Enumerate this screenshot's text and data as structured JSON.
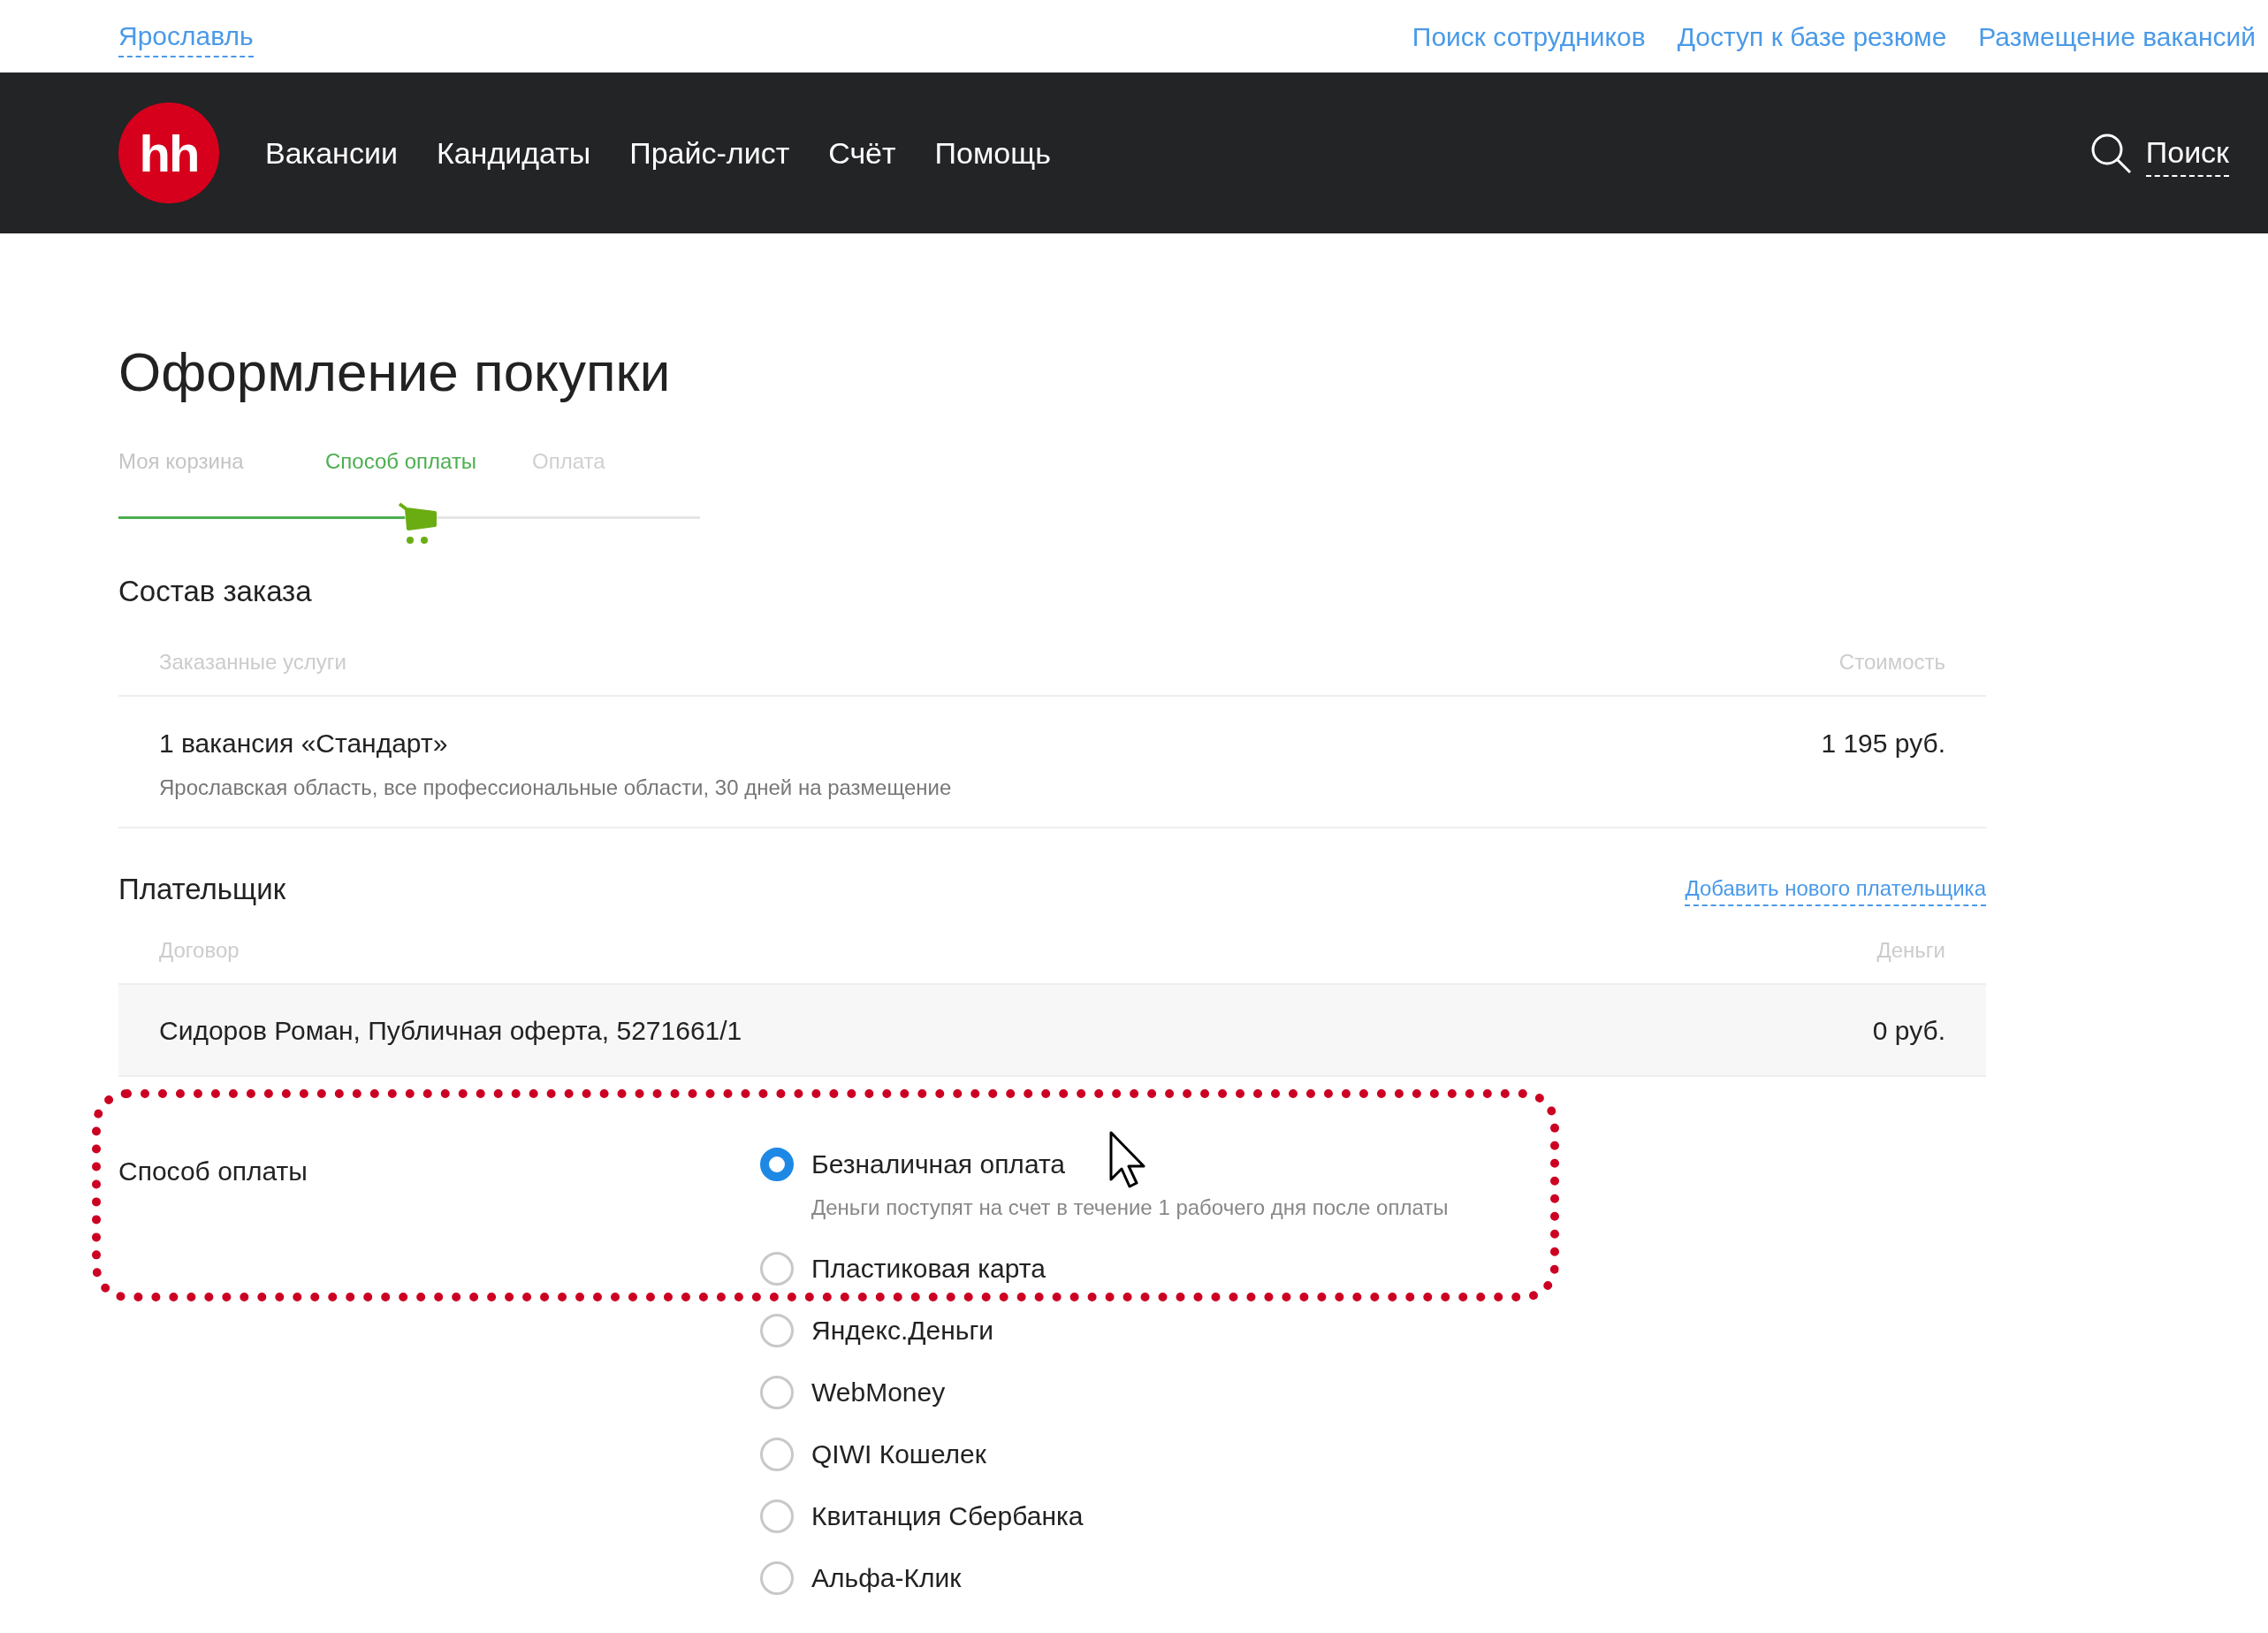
{
  "top_bar": {
    "city": "Ярославль",
    "links": [
      "Поиск сотрудников",
      "Доступ к базе резюме",
      "Размещение вакансий"
    ]
  },
  "navbar": {
    "logo": "hh",
    "items": [
      "Вакансии",
      "Кандидаты",
      "Прайс-лист",
      "Счёт",
      "Помощь"
    ],
    "search": "Поиск"
  },
  "title": "Оформление покупки",
  "steps": [
    {
      "label": "Моя корзина",
      "done": true,
      "selected": false
    },
    {
      "label": "Способ оплаты",
      "done": false,
      "selected": true
    },
    {
      "label": "Оплата",
      "done": false,
      "selected": false
    }
  ],
  "order": {
    "heading": "Состав заказа",
    "columns": [
      "Заказанные услуги",
      "Стоимость"
    ],
    "rows": [
      {
        "name": "1 вакансия «Стандарт»",
        "details": "Ярославская область, все профессиональные области, 30 дней на размещение",
        "price": "1 195 руб."
      }
    ]
  },
  "payer": {
    "heading": "Плательщик",
    "add_link": "Добавить нового плательщика",
    "columns": [
      "Договор",
      "Деньги"
    ],
    "rows": [
      {
        "name": "Сидоров Роман, Публичная оферта, 5271661/1",
        "money": "0 руб."
      }
    ]
  },
  "payment": {
    "label": "Способ оплаты",
    "options": [
      {
        "label": "Безналичная оплата",
        "selected": true,
        "hint": "Деньги поступят на счет в течение 1 рабочего дня после оплаты"
      },
      {
        "label": "Пластиковая карта",
        "selected": false
      },
      {
        "label": "Яндекс.Деньги",
        "selected": false
      },
      {
        "label": "WebMoney",
        "selected": false
      },
      {
        "label": "QIWI Кошелек",
        "selected": false
      },
      {
        "label": "Квитанция Сбербанка",
        "selected": false
      },
      {
        "label": "Альфа-Клик",
        "selected": false
      }
    ]
  }
}
